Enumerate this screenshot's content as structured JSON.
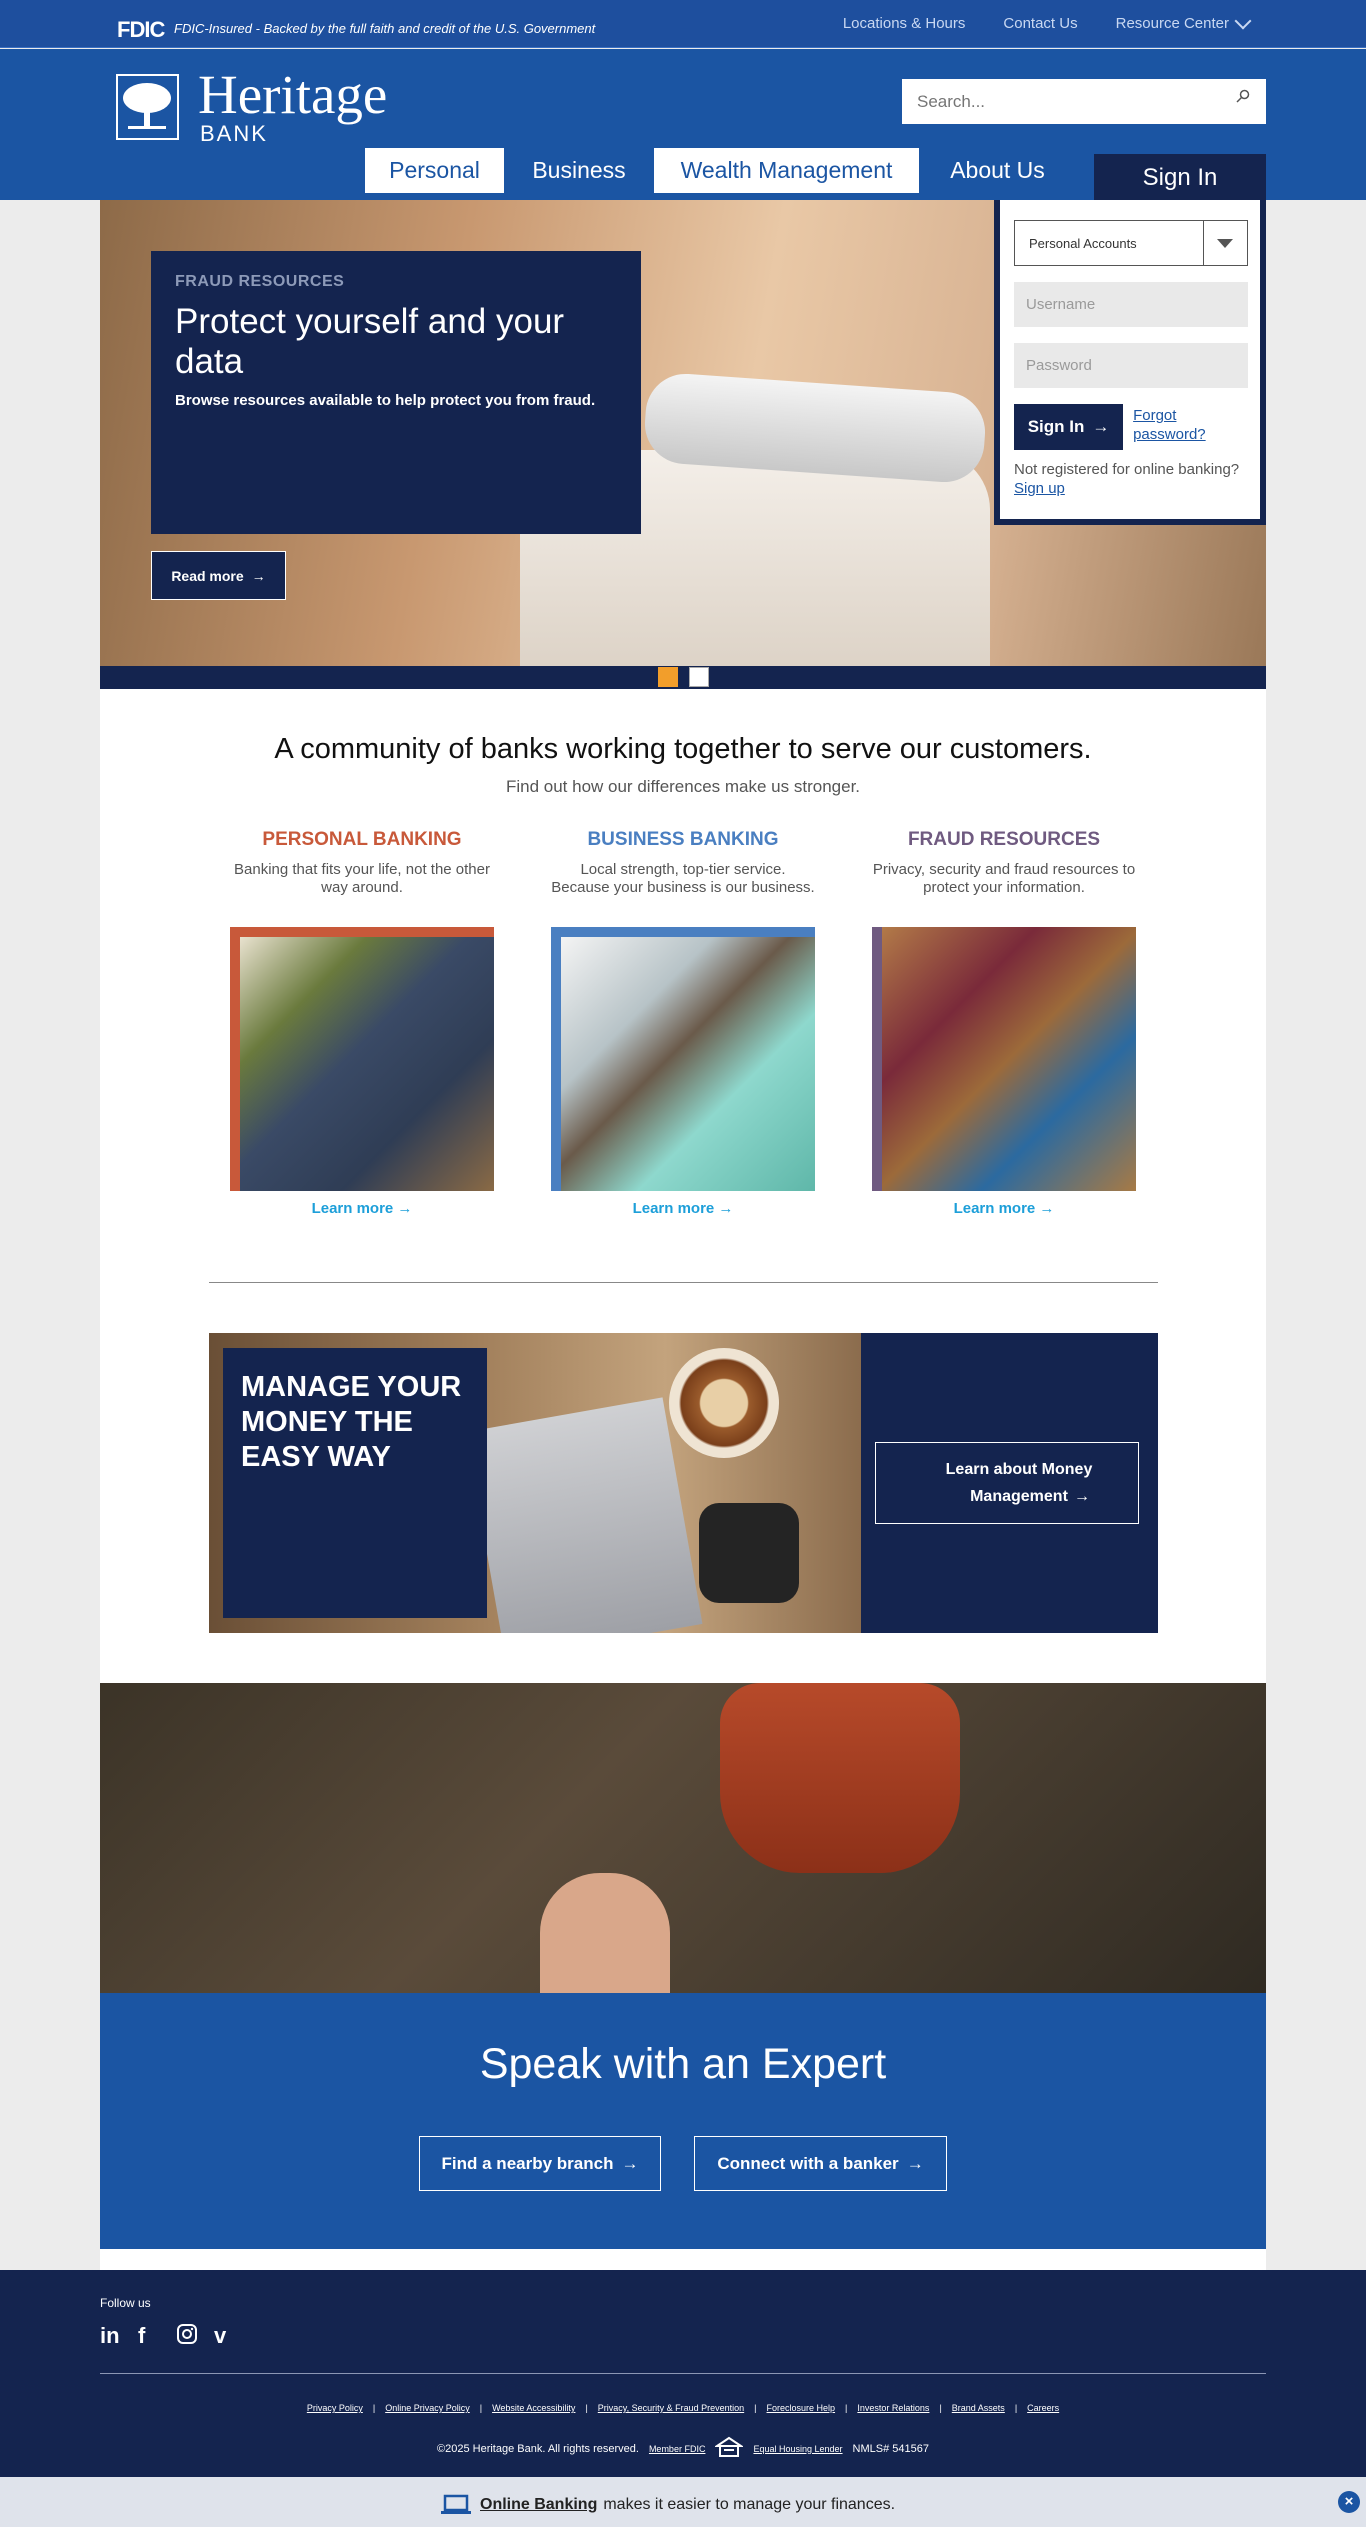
{
  "fdic": {
    "logo": "FDIC",
    "text": "FDIC-Insured - Backed by the full faith and credit of the U.S. Government"
  },
  "util_nav": {
    "locations": "Locations & Hours",
    "contact": "Contact Us",
    "resource": "Resource Center"
  },
  "brand": {
    "name": "Heritage",
    "sub": "BANK"
  },
  "search": {
    "placeholder": "Search..."
  },
  "main_nav": {
    "personal": "Personal",
    "business": "Business",
    "wealth": "Wealth Management",
    "about": "About Us"
  },
  "hero": {
    "kicker": "FRAUD RESOURCES",
    "title": "Protect yourself and your data",
    "desc": "Browse resources available to help protect you from fraud.",
    "button": "Read more"
  },
  "signin": {
    "tab": "Sign In",
    "account_select": "Personal Accounts",
    "username_placeholder": "Username",
    "password_placeholder": "Password",
    "button": "Sign In",
    "forgot": "Forgot password?",
    "not_registered": "Not registered for online banking?",
    "signup": "Sign up"
  },
  "community": {
    "title": "A community of banks working together to serve our customers.",
    "subtitle": "Find out how our differences make us stronger.",
    "columns": [
      {
        "title": "PERSONAL BANKING",
        "desc": "Banking that fits your life, not the other way around.",
        "link": "Learn more",
        "color": "#c8593a"
      },
      {
        "title": "BUSINESS BANKING",
        "desc": "Local strength, top-tier service. Because your business is our business.",
        "link": "Learn more",
        "color": "#4a7fc1"
      },
      {
        "title": "FRAUD RESOURCES",
        "desc": "Privacy, security and fraud resources to protect your information.",
        "link": "Learn more",
        "color": "#6f5a80"
      }
    ]
  },
  "manage": {
    "title": "MANAGE YOUR MONEY THE EASY WAY",
    "button": "Learn about Money Management"
  },
  "expert": {
    "title": "Speak with an Expert",
    "branch_button": "Find a nearby branch",
    "banker_button": "Connect with a banker"
  },
  "footer": {
    "follow": "Follow us",
    "links": [
      "Privacy Policy",
      "Online Privacy Policy",
      "Website Accessibility",
      "Privacy, Security & Fraud Prevention",
      "Foreclosure Help",
      "Investor Relations",
      "Brand Assets",
      "Careers"
    ],
    "copyright": "©2025 Heritage Bank. All rights reserved.",
    "member_fdic": "Member FDIC",
    "equal_housing": "Equal Housing Lender",
    "nmls": "NMLS# 541567"
  },
  "banner": {
    "bold": "Online Banking",
    "text": "makes it easier to manage your finances."
  },
  "colors": {
    "navy": "#14244f",
    "blue": "#1b55a3",
    "accent_orange": "#f29e2b",
    "link_blue": "#1d9fd9"
  }
}
